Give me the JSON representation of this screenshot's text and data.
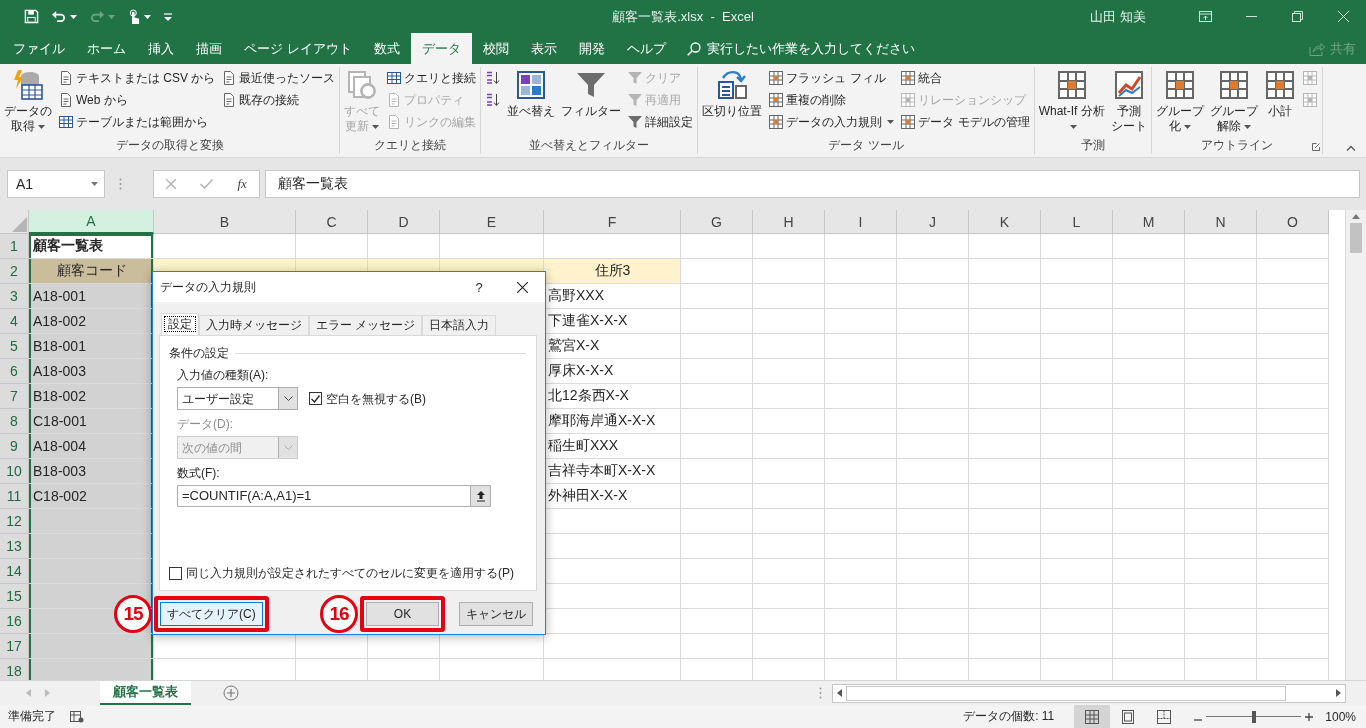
{
  "quick_access": [
    {
      "kind": "save",
      "dropdown": false,
      "disabled": false
    },
    {
      "kind": "undo",
      "dropdown": true,
      "disabled": false
    },
    {
      "kind": "redo",
      "dropdown": true,
      "disabled": true
    },
    {
      "kind": "touch",
      "dropdown": true,
      "disabled": false
    },
    {
      "kind": "customize",
      "dropdown": false,
      "disabled": false
    }
  ],
  "window": {
    "title": "顧客一覧表.xlsx  -  Excel",
    "user": "山田 知美"
  },
  "ribbon_tabs": [
    {
      "label": "ファイル",
      "selected": false
    },
    {
      "label": "ホーム",
      "selected": false
    },
    {
      "label": "挿入",
      "selected": false
    },
    {
      "label": "描画",
      "selected": false
    },
    {
      "label": "ページ レイアウト",
      "selected": false
    },
    {
      "label": "数式",
      "selected": false
    },
    {
      "label": "データ",
      "selected": true
    },
    {
      "label": "校閲",
      "selected": false
    },
    {
      "label": "表示",
      "selected": false
    },
    {
      "label": "開発",
      "selected": false
    },
    {
      "label": "ヘルプ",
      "selected": false
    }
  ],
  "tell_me": {
    "placeholder": "実行したい作業を入力してください"
  },
  "share": {
    "label": "共有",
    "disabled": true
  },
  "ribbon_groups": [
    {
      "label": "データの取得と変換",
      "launcher": false,
      "items": [
        {
          "kind": "large",
          "label": "データの取得",
          "dropdown": true,
          "disabled": false
        },
        {
          "kind": "small",
          "label": "テキストまたは CSV から",
          "dropdown": false,
          "disabled": false
        },
        {
          "kind": "small",
          "label": "Web から",
          "dropdown": false,
          "disabled": false
        },
        {
          "kind": "small",
          "label": "テーブルまたは範囲から",
          "dropdown": false,
          "disabled": false
        },
        {
          "kind": "small",
          "label": "最近使ったソース",
          "dropdown": false,
          "disabled": false
        },
        {
          "kind": "small",
          "label": "既存の接続",
          "dropdown": false,
          "disabled": false
        }
      ]
    },
    {
      "label": "クエリと接続",
      "launcher": false,
      "items": [
        {
          "kind": "large",
          "label": "すべて更新",
          "dropdown": true,
          "disabled": true
        },
        {
          "kind": "small",
          "label": "クエリと接続",
          "dropdown": false,
          "disabled": false
        },
        {
          "kind": "small",
          "label": "プロパティ",
          "dropdown": false,
          "disabled": true
        },
        {
          "kind": "small",
          "label": "リンクの編集",
          "dropdown": false,
          "disabled": true
        }
      ]
    },
    {
      "label": "並べ替えとフィルター",
      "launcher": false,
      "items": [
        {
          "kind": "icon",
          "disabled": false
        },
        {
          "kind": "icon",
          "disabled": false
        },
        {
          "kind": "large",
          "label": "並べ替え",
          "dropdown": false,
          "disabled": false
        },
        {
          "kind": "large",
          "label": "フィルター",
          "dropdown": false,
          "disabled": false
        },
        {
          "kind": "small",
          "label": "クリア",
          "dropdown": false,
          "disabled": true
        },
        {
          "kind": "small",
          "label": "再適用",
          "dropdown": false,
          "disabled": true
        },
        {
          "kind": "small",
          "label": "詳細設定",
          "dropdown": false,
          "disabled": false
        }
      ]
    },
    {
      "label": "データ ツール",
      "launcher": false,
      "items": [
        {
          "kind": "large",
          "label": "区切り位置",
          "dropdown": false,
          "disabled": false
        },
        {
          "kind": "small",
          "label": "フラッシュ フィル",
          "dropdown": false,
          "disabled": false
        },
        {
          "kind": "small",
          "label": "重複の削除",
          "dropdown": false,
          "disabled": false
        },
        {
          "kind": "small",
          "label": "データの入力規則",
          "dropdown": true,
          "disabled": false
        },
        {
          "kind": "small",
          "label": "統合",
          "dropdown": false,
          "disabled": false
        },
        {
          "kind": "small",
          "label": "リレーションシップ",
          "dropdown": false,
          "disabled": true
        },
        {
          "kind": "small",
          "label": "データ モデルの管理",
          "dropdown": false,
          "disabled": false
        }
      ]
    },
    {
      "label": "予測",
      "launcher": false,
      "items": [
        {
          "kind": "large",
          "label": "What-If 分析",
          "dropdown": true,
          "disabled": false
        },
        {
          "kind": "large",
          "label": "予測シート",
          "dropdown": false,
          "disabled": false
        }
      ]
    },
    {
      "label": "アウトライン",
      "launcher": true,
      "items": [
        {
          "kind": "large",
          "label": "グループ化",
          "dropdown": true,
          "disabled": false
        },
        {
          "kind": "large",
          "label": "グループ解除",
          "dropdown": true,
          "disabled": false
        },
        {
          "kind": "large",
          "label": "小計",
          "dropdown": false,
          "disabled": false
        },
        {
          "kind": "icon",
          "disabled": true
        },
        {
          "kind": "icon",
          "disabled": true
        }
      ]
    }
  ],
  "formula_bar": {
    "name_box": "A1",
    "function_label": "fx",
    "formula": "顧客一覧表"
  },
  "sheet": {
    "columns": [
      {
        "label": "A",
        "selected": true
      },
      {
        "label": "B",
        "selected": false
      },
      {
        "label": "C",
        "selected": false
      },
      {
        "label": "D",
        "selected": false
      },
      {
        "label": "E",
        "selected": false
      },
      {
        "label": "F",
        "selected": false
      },
      {
        "label": "G",
        "selected": false
      },
      {
        "label": "H",
        "selected": false
      },
      {
        "label": "I",
        "selected": false
      },
      {
        "label": "J",
        "selected": false
      },
      {
        "label": "K",
        "selected": false
      },
      {
        "label": "L",
        "selected": false
      },
      {
        "label": "M",
        "selected": false
      },
      {
        "label": "N",
        "selected": false
      },
      {
        "label": "O",
        "selected": false
      }
    ],
    "rows": [
      {
        "number": "1",
        "kind": "title",
        "cells": {
          "A": "顧客一覧表"
        }
      },
      {
        "number": "2",
        "kind": "header",
        "cells": {
          "A": "顧客コード",
          "F": "住所3"
        }
      },
      {
        "number": "3",
        "kind": "data",
        "cells": {
          "A": "A18-001",
          "F": "高野XXX"
        }
      },
      {
        "number": "4",
        "kind": "data",
        "cells": {
          "A": "A18-002",
          "F": "下連雀X-X-X"
        }
      },
      {
        "number": "5",
        "kind": "data",
        "cells": {
          "A": "B18-001",
          "F": "鷲宮X-X"
        }
      },
      {
        "number": "6",
        "kind": "data",
        "cells": {
          "A": "A18-003",
          "F": "厚床X-X-X"
        }
      },
      {
        "number": "7",
        "kind": "data",
        "cells": {
          "A": "B18-002",
          "F": "北12条西X-X"
        }
      },
      {
        "number": "8",
        "kind": "data",
        "cells": {
          "A": "C18-001",
          "F": "摩耶海岸通X-X-X"
        }
      },
      {
        "number": "9",
        "kind": "data",
        "cells": {
          "A": "A18-004",
          "F": "稲生町XXX"
        }
      },
      {
        "number": "10",
        "kind": "data",
        "cells": {
          "A": "B18-003",
          "F": "吉祥寺本町X-X-X"
        }
      },
      {
        "number": "11",
        "kind": "data",
        "cells": {
          "A": "C18-002",
          "F": "外神田X-X-X"
        }
      },
      {
        "number": "12",
        "kind": "data"
      },
      {
        "number": "13",
        "kind": "data"
      },
      {
        "number": "14",
        "kind": "data"
      },
      {
        "number": "15",
        "kind": "data"
      },
      {
        "number": "16",
        "kind": "data"
      },
      {
        "number": "17",
        "kind": "data"
      },
      {
        "number": "18",
        "kind": "data"
      }
    ]
  },
  "dialog": {
    "title": "データの入力規則",
    "help": "?",
    "tabs": [
      {
        "label": "設定",
        "selected": true
      },
      {
        "label": "入力時メッセージ",
        "selected": false
      },
      {
        "label": "エラー メッセージ",
        "selected": false
      },
      {
        "label": "日本語入力",
        "selected": false
      }
    ],
    "section": "条件の設定",
    "fields": [
      {
        "kind": "select",
        "label": "入力値の種類(A):",
        "value": "ユーザー設定",
        "disabled": false
      },
      {
        "kind": "select",
        "label": "データ(D):",
        "value": "次の値の間",
        "disabled": true
      },
      {
        "kind": "formula",
        "label": "数式(F):",
        "value": "=COUNTIF(A:A,A1)=1",
        "disabled": false
      }
    ],
    "ignore_blank": {
      "label": "空白を無視する(B)",
      "checked": true
    },
    "apply_all": {
      "label": "同じ入力規則が設定されたすべてのセルに変更を適用する(P)",
      "checked": false
    },
    "buttons": [
      {
        "label": "すべてクリア(C)",
        "highlighted": true,
        "callout": "15"
      },
      {
        "label": "OK",
        "highlighted": true,
        "callout": "16"
      },
      {
        "label": "キャンセル",
        "highlighted": false
      }
    ]
  },
  "sheet_tabs": [
    {
      "label": "顧客一覧表",
      "selected": true
    }
  ],
  "status": {
    "ready": "準備完了",
    "count": "データの個数: 11",
    "views": [
      {
        "kind": "normal",
        "selected": true
      },
      {
        "kind": "layout",
        "selected": false
      },
      {
        "kind": "break",
        "selected": false
      }
    ],
    "zoom": {
      "level": 0.5,
      "label": "100%"
    }
  }
}
